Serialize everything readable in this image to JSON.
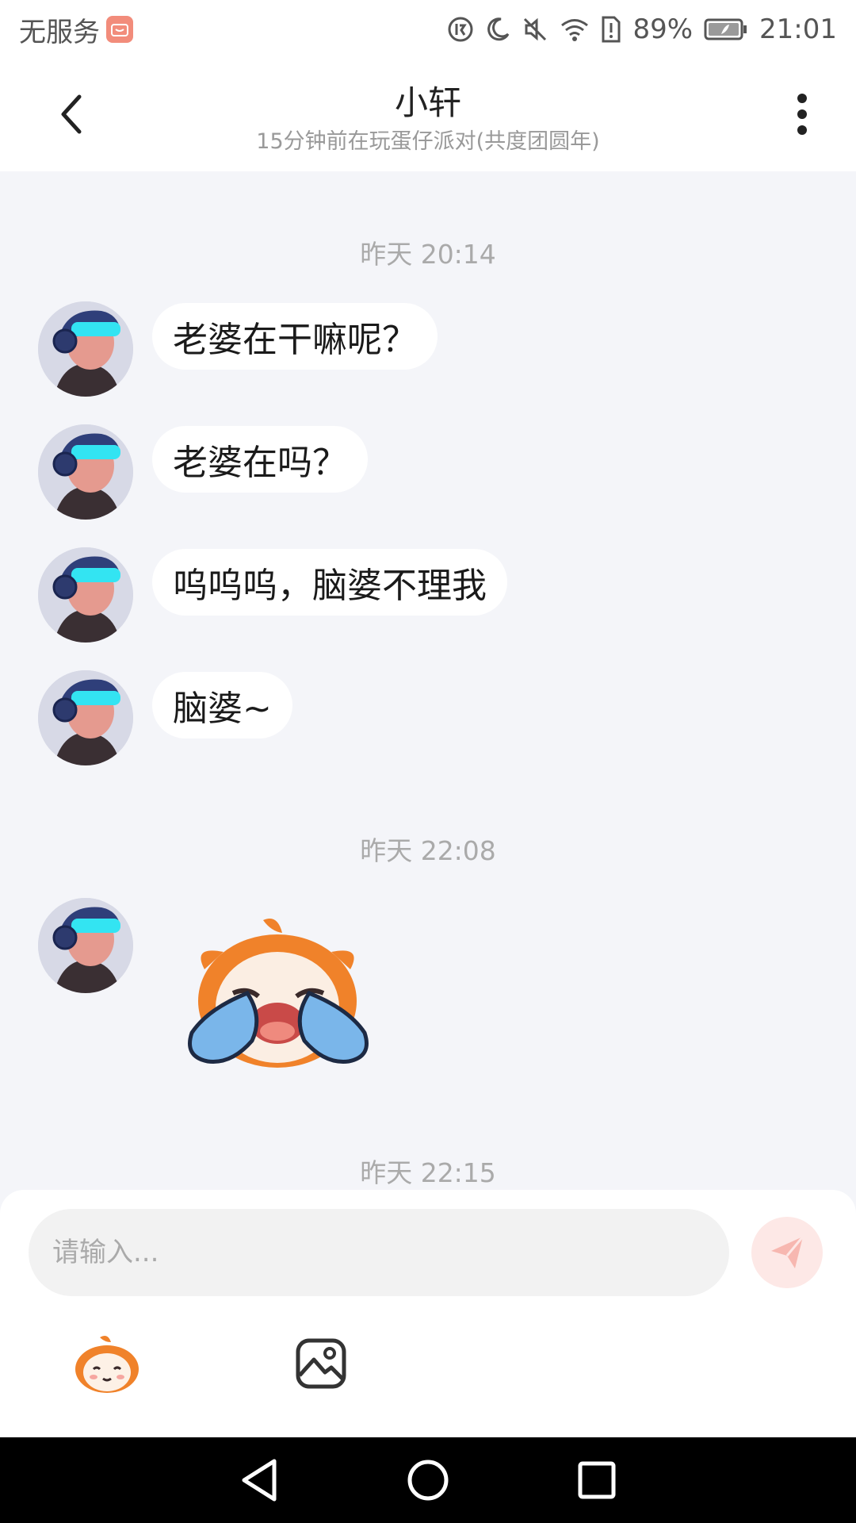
{
  "status_bar": {
    "carrier": "无服务",
    "battery": "89%",
    "time": "21:01",
    "icons": [
      "app-notification-icon",
      "data-saver-icon",
      "moon-icon",
      "mute-icon",
      "wifi-icon",
      "sim-alert-icon",
      "battery-icon"
    ]
  },
  "header": {
    "title": "小轩",
    "subtitle": "15分钟前在玩蛋仔派对(共度团圆年)",
    "icons": [
      "back-arrow-icon",
      "more-vertical-icon"
    ]
  },
  "chat": {
    "time1": "昨天 20:14",
    "messages": [
      {
        "text": "老婆在干嘛呢？"
      },
      {
        "text": "老婆在吗？"
      },
      {
        "text": "呜呜呜，脑婆不理我"
      },
      {
        "text": "脑婆~"
      }
    ],
    "time2": "昨天 22:08",
    "sticker": "crying-eggy-sticker",
    "time3": "昨天 22:15"
  },
  "input": {
    "placeholder": "请输入...",
    "icons": [
      "send-icon",
      "emoji-icon",
      "image-icon"
    ]
  },
  "nav": {
    "icons": [
      "nav-back-icon",
      "nav-home-icon",
      "nav-recents-icon"
    ]
  },
  "colors": {
    "chat_background": "#f4f5f9",
    "bubble": "#ffffff",
    "send_button": "#fde8e6",
    "accent": "#f28c7b"
  }
}
